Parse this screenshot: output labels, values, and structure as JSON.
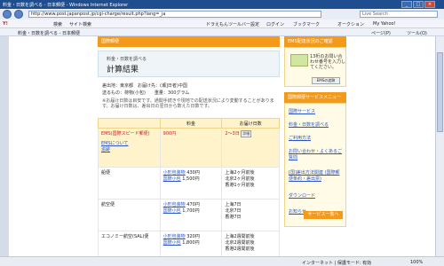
{
  "window": {
    "title": "料金・日数を調べる - 日本郵便 - Windows Internet Explorer"
  },
  "address_bar": {
    "url": "http://www.post.japanpost.jp/cgi-charge/result.php?lang=_ja",
    "search_placeholder": "Live Search",
    "extra": "にほんご_IMEが有効です"
  },
  "toolbar": {
    "yahoo": "Y!",
    "items": [
      "検索",
      "サイト検索",
      "ドラえもんツールバー設定",
      "ログイン",
      "ブックマーク",
      "オークション",
      "My Yahoo!"
    ]
  },
  "tab": {
    "label": "料金・日数を調べる - 日本郵便",
    "right_tools": [
      "ページ(P)",
      "ツール(O)"
    ]
  },
  "page": {
    "header_label": "国際郵便",
    "panel_sub": "料金・日数を調べる",
    "panel_title": "計算結果",
    "from_to": "差出地：東京都　お届け先：(瀬]日者)中国",
    "content": "送るもの：荷物(小包)　　重量：300グラム",
    "note": "※お届け日数は目安です。通関手続きや現地での配送状況により変動することがあります。お届け日数は、差出日の翌日から数えた日数です。"
  },
  "table": {
    "col_price": "料金",
    "col_days": "お届け日数",
    "ems": {
      "name": "EMS(国際スピード郵便)",
      "price": "900円",
      "days": "2〜3日",
      "days_badge": "詳細",
      "link1": "EMSについて",
      "link2": "追跡"
    },
    "rows": [
      {
        "name": "船便",
        "l1": "小形包装物",
        "p1": "430円",
        "l2": "国際小包",
        "p2": "1,500円",
        "d1": "上海2ヶ月前後",
        "d2": "北京2ヶ月前後",
        "d3": "香港1ヶ月前後"
      },
      {
        "name": "航空便",
        "l1": "小形包装物",
        "p1": "470円",
        "l2": "国際小包",
        "p2": "1,700円",
        "d1": "上海7日",
        "d2": "北京7日",
        "d3": "香港7日"
      },
      {
        "name": "エコノミー航空(SAL)便",
        "l1": "小形包装物",
        "p1": "320円",
        "l2": "国際小包",
        "p2": "1,800円",
        "d1": "上海2週間前後",
        "d2": "北京2週間前後",
        "d3": "香港2週間前後"
      }
    ]
  },
  "sidebar": {
    "ems_head": "EMS配達状況のご確認",
    "ems_text": "13桁のお問い合わせ番号を入力してください。",
    "ems_button": "EMSの追跡",
    "svc_head": "国際郵便サービスメニュー",
    "items": [
      "国際サービス",
      "料金・日数を調べる",
      "ご利用方法",
      "お問い合わせ・よくあるご質問",
      "[国]差出方法関連 (国際郵便条約・差出票)",
      "ダウンロード",
      "お知らせ"
    ],
    "more": "サービス一覧へ"
  },
  "status": {
    "zone": "インターネット | 保護モード: 有効",
    "zoom": "100%"
  }
}
